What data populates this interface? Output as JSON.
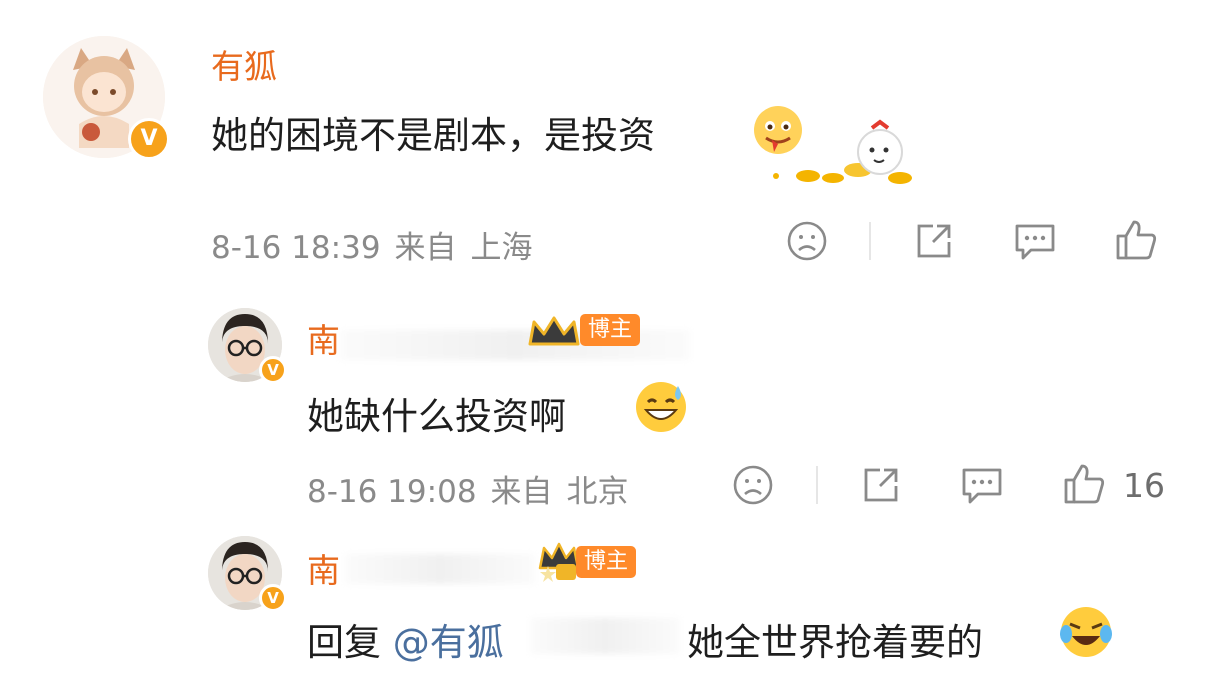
{
  "comments": [
    {
      "name": "有狐",
      "content": "她的困境不是剧本，是投资",
      "meta": {
        "date": "8-16 18:39",
        "from": "来自",
        "location": "上海"
      },
      "likes": ""
    },
    {
      "name": "南",
      "badge": "博主",
      "content": "她缺什么投资啊",
      "meta": {
        "date": "8-16 19:08",
        "from": "来自",
        "location": "北京"
      },
      "likes": "16"
    },
    {
      "name": "南",
      "badge": "博主",
      "reply_prefix": "回复",
      "mention": "@有狐",
      "content": "她全世界抢着要的"
    }
  ],
  "icons": {
    "verified": "verified-v-badge",
    "dislike": "sad-face-icon",
    "share": "share-icon",
    "comment": "comment-icon",
    "like": "thumbs-up-icon"
  },
  "colors": {
    "name": "#e86a1d",
    "meta": "#8a8a8a",
    "badge": "#ff8a2a",
    "verified": "#f7a21b",
    "mention": "#4a6f9e"
  }
}
